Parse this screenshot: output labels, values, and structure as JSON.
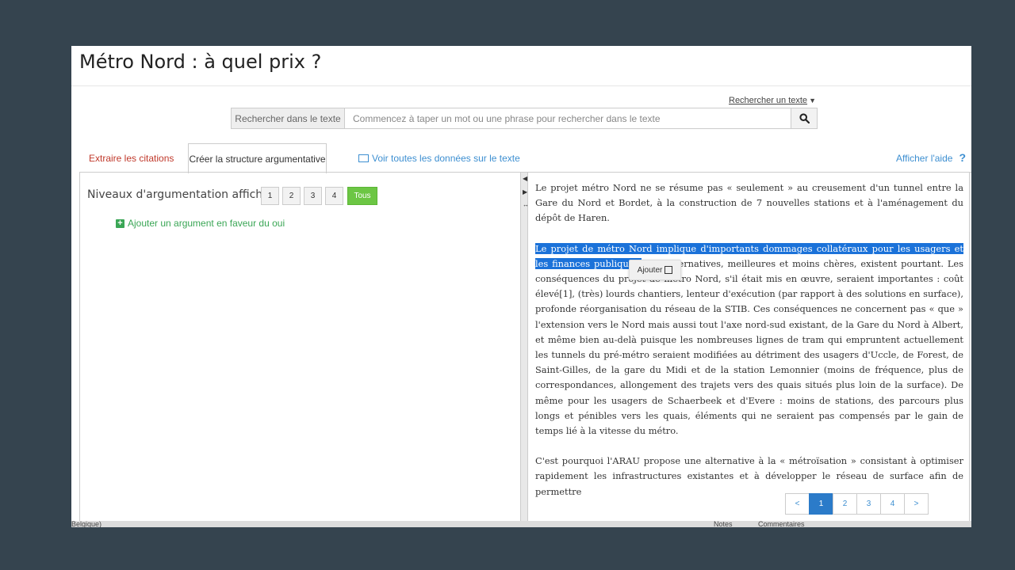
{
  "header": {
    "title": "Métro Nord : à quel prix ?"
  },
  "search": {
    "toggle_label": "Rechercher un texte",
    "label": "Rechercher dans le texte",
    "placeholder": "Commencez à taper un mot ou une phrase pour rechercher dans le texte",
    "button_icon": "search-icon"
  },
  "tabs": [
    {
      "label": "Extraire les citations",
      "active": false
    },
    {
      "label": "Créer la structure argumentative",
      "active": true
    },
    {
      "label": "Voir toutes les données sur le texte",
      "active": false
    }
  ],
  "help": {
    "label": "Afficher l'aide",
    "icon": "?"
  },
  "left": {
    "levels_label": "Niveaux d'argumentation affichés",
    "levels": [
      "1",
      "2",
      "3",
      "4",
      "Tous"
    ],
    "add_argument": "Ajouter un argument en faveur du oui"
  },
  "text": {
    "p1": "Le projet métro Nord ne se résume pas « seulement » au creusement d'un tunnel entre la Gare du Nord et Bordet, à la construction de 7 nouvelles stations et à l'aménagement du dépôt de Haren.",
    "p2_selected": "Le projet de métro Nord implique d'importants dommages collatéraux pour les usagers et les finances publiques.",
    "p2_rest": " Des alternatives, meilleures et moins chères, existent pourtant. Les conséquences du projet de métro Nord, s'il était mis en œuvre, seraient importantes : coût élevé[1], (très) lourds chantiers, lenteur d'exécution (par rapport à des solutions en surface), profonde réorganisation du réseau de la STIB. Ces conséquences ne concernent pas « que » l'extension vers le Nord mais aussi tout l'axe nord-sud existant, de la Gare du Nord à Albert, et même bien au-delà puisque les nombreuses lignes de tram qui empruntent actuellement les tunnels du pré-métro seraient modifiées au détriment des usagers d'Uccle, de Forest, de Saint-Gilles, de la gare du Midi et de la station Lemonnier (moins de fréquence, plus de correspondances, allongement des trajets vers des quais situés plus loin de la surface). De même pour les usagers de Schaerbeek et d'Evere : moins de stations, des parcours plus longs et pénibles vers les quais, éléments qui ne seraient pas compensés par le gain de temps lié à la vitesse du métro.",
    "p3": "C'est pourquoi l'ARAU propose une alternative à la « métroïsation » consistant à optimiser rapidement les infrastructures existantes et à développer le réseau de surface afin de permettre"
  },
  "popup": {
    "label": "Ajouter",
    "icon": "edit-icon"
  },
  "pagination": {
    "prev": "<",
    "pages": [
      "1",
      "2",
      "3",
      "4"
    ],
    "current": "1",
    "next": ">"
  },
  "statusbar": {
    "left": "Belgique)",
    "notes": "Notes",
    "comments": "Commentaires"
  },
  "colors": {
    "accent": "#3d8fd1",
    "selection": "#1b72d9",
    "tous": "#6cc644",
    "add_green": "#3aa655",
    "citations_red": "#c0392b",
    "background": "#35444f"
  }
}
